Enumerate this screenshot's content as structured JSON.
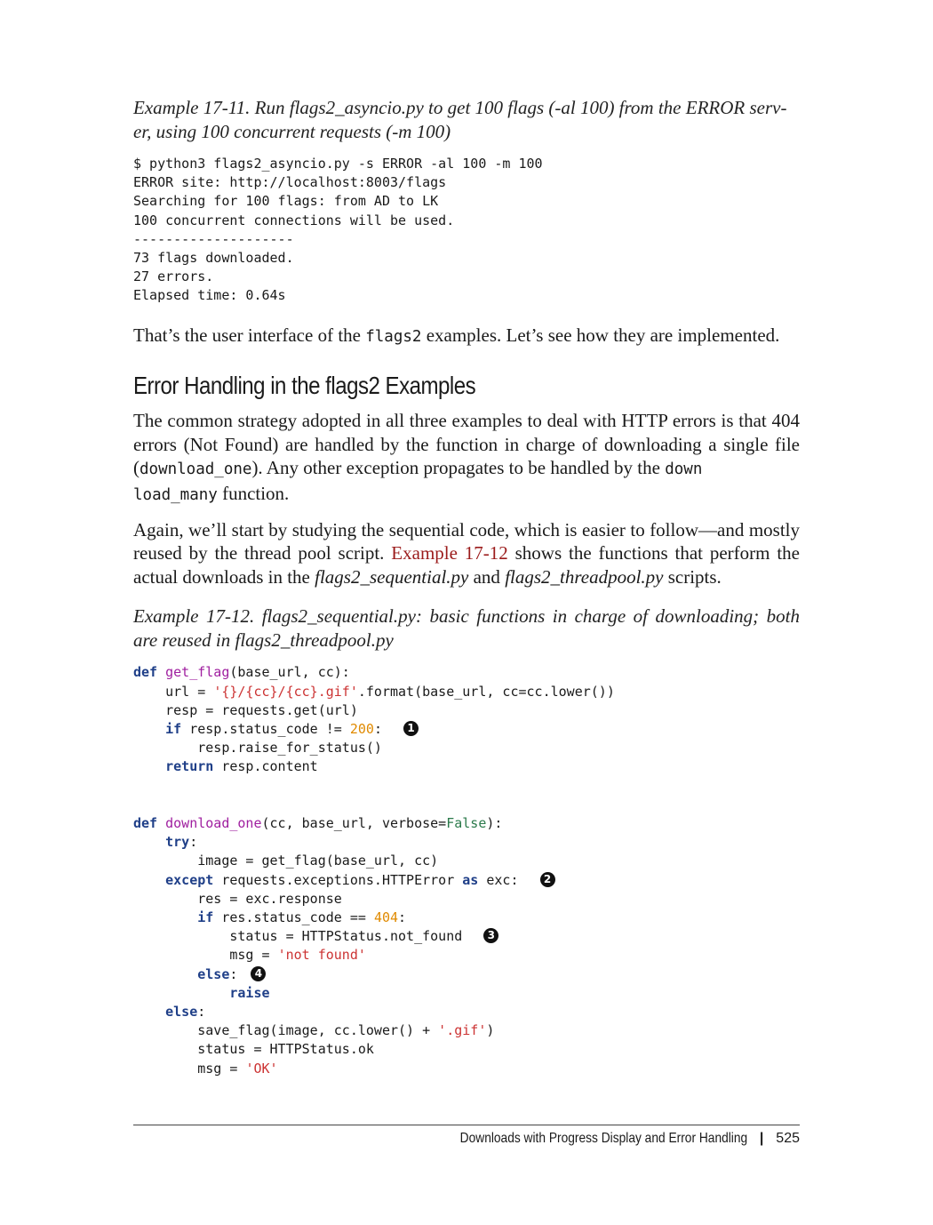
{
  "example_11": {
    "caption_line1": "Example 17-11. Run flags2_asyncio.py to get 100 flags (-al 100) from the ERROR serv-",
    "caption_line2": "er, using 100 concurrent requests (-m 100)",
    "output": [
      "$ python3 flags2_asyncio.py -s ERROR -al 100 -m 100",
      "ERROR site: http://localhost:8003/flags",
      "Searching for 100 flags: from AD to LK",
      "100 concurrent connections will be used.",
      "--------------------",
      "73 flags downloaded.",
      "27 errors.",
      "Elapsed time: 0.64s"
    ]
  },
  "para1": {
    "before": "That’s the user interface of the ",
    "code": "flags2",
    "after": " examples. Let’s see how they are implemented."
  },
  "heading": "Error Handling in the flags2 Examples",
  "para2": {
    "part1": "The common strategy adopted in all three examples to deal with HTTP errors is that 404 errors (Not Found) are handled by the function in charge of downloading a single file (",
    "code1": "download_one",
    "part2": "). Any other exception propagates to be handled by the ",
    "code2a": "down",
    "code2b": "load_many",
    "part3": " function."
  },
  "para3": {
    "part1": "Again, we’ll start by studying the sequential code, which is easier to follow—and mostly reused by the thread pool script. ",
    "xref": "Example 17-12",
    "part2": " shows the functions that perform the actual downloads in the ",
    "file1": "flags2_sequential.py",
    "part3": " and ",
    "file2": "flags2_threadpool.py",
    "part4": " scripts."
  },
  "example_12": {
    "caption_line1": "Example 17-12. flags2_sequential.py: basic functions in charge of downloading; both",
    "caption_line2": "are reused in flags2_threadpool.py"
  },
  "callouts": [
    "1",
    "2",
    "3",
    "4"
  ],
  "footer": {
    "title": "Downloads with Progress Display and Error Handling",
    "separator": "|",
    "page_number": "525"
  }
}
